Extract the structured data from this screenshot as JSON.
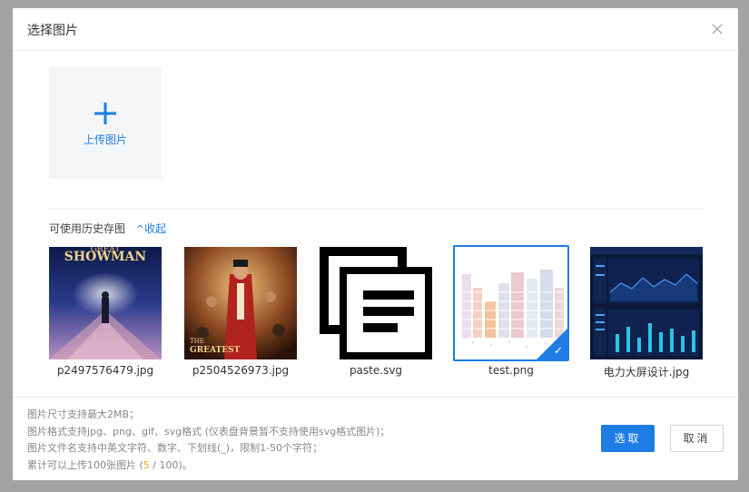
{
  "dialog": {
    "title": "选择图片"
  },
  "upload": {
    "label": "上传图片"
  },
  "history": {
    "label": "可使用历史存图",
    "collapse_label": "收起",
    "images": [
      {
        "name": "p2497576479.jpg",
        "selected": false
      },
      {
        "name": "p2504526973.jpg",
        "selected": false
      },
      {
        "name": "paste.svg",
        "selected": false
      },
      {
        "name": "test.png",
        "selected": true
      },
      {
        "name": "电力大屏设计.jpg",
        "selected": false
      }
    ]
  },
  "thumb_texts": {
    "showman_title": "SHOWMAN",
    "showman_sup": "GREAT",
    "greatest_line1": "THE",
    "greatest_line2": "GREATEST"
  },
  "footer": {
    "note1": "图片尺寸支持最大2MB；",
    "note2": "图片格式支持jpg、png、gif、svg格式 (仪表盘背景暂不支持使用svg格式图片)；",
    "note3": "图片文件名支持中英文字符、数字、下划线(_)，限制1-50个字符；",
    "note4_prefix": "累计可以上传100张图片 (",
    "count_current": "5",
    "note4_suffix": " / 100)。",
    "confirm_label": "选取",
    "cancel_label": "取消"
  },
  "colors": {
    "accent": "#1e7ee6",
    "count_highlight": "#f5a623",
    "overlay": "#a3a3a3"
  }
}
